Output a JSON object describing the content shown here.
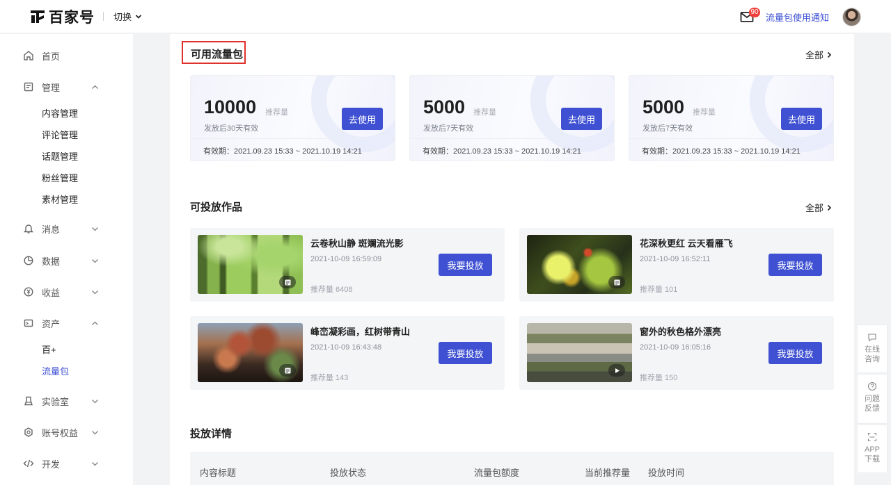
{
  "header": {
    "brand": "百家号",
    "switch_label": "切换",
    "badge_count": "90",
    "notice_link": "流量包使用通知"
  },
  "sidebar": {
    "home": "首页",
    "manage": "管理",
    "manage_items": [
      "内容管理",
      "评论管理",
      "话题管理",
      "粉丝管理",
      "素材管理"
    ],
    "message": "消息",
    "data": "数据",
    "income": "收益",
    "assets": "资产",
    "assets_items": [
      "百+",
      "流量包"
    ],
    "lab": "实验室",
    "rights": "账号权益",
    "dev": "开发"
  },
  "packages": {
    "title": "可用流量包",
    "all_label": "全部",
    "unit": "推荐量",
    "use_label": "去使用",
    "items": [
      {
        "amount": "10000",
        "note": "发放后30天有效",
        "validity": "有效期：2021.09.23 15:33 ~ 2021.10.19 14:21"
      },
      {
        "amount": "5000",
        "note": "发放后7天有效",
        "validity": "有效期：2021.09.23 15:33 ~ 2021.10.19 14:21"
      },
      {
        "amount": "5000",
        "note": "发放后7天有效",
        "validity": "有效期：2021.09.23 15:33 ~ 2021.10.19 14:21"
      }
    ]
  },
  "works": {
    "title": "可投放作品",
    "all_label": "全部",
    "cta": "我要投放",
    "items": [
      {
        "title": "云卷秋山静 斑斓流光影",
        "time": "2021-10-09 16:59:09",
        "rec": "推荐量 6408",
        "type": "article"
      },
      {
        "title": "花深秋更红 云天看雁飞",
        "time": "2021-10-09 16:52:11",
        "rec": "推荐量 101",
        "type": "article"
      },
      {
        "title": "峰峦凝彩画，红树带青山",
        "time": "2021-10-09 16:43:48",
        "rec": "推荐量 143",
        "type": "article"
      },
      {
        "title": "窗外的秋色格外漂亮",
        "time": "2021-10-09 16:05:16",
        "rec": "推荐量 150",
        "type": "video"
      }
    ]
  },
  "details": {
    "title": "投放详情",
    "columns": [
      "内容标题",
      "投放状态",
      "流量包额度",
      "当前推荐量",
      "投放时间"
    ]
  },
  "float_tools": [
    {
      "line1": "在线",
      "line2": "咨询"
    },
    {
      "line1": "问题",
      "line2": "反馈"
    },
    {
      "line1": "APP",
      "line2": "下载"
    }
  ],
  "colors": {
    "accent": "#3f51d2",
    "link": "#3a4ed3",
    "badge": "#f1403c",
    "highlight_box": "#e0302b"
  }
}
